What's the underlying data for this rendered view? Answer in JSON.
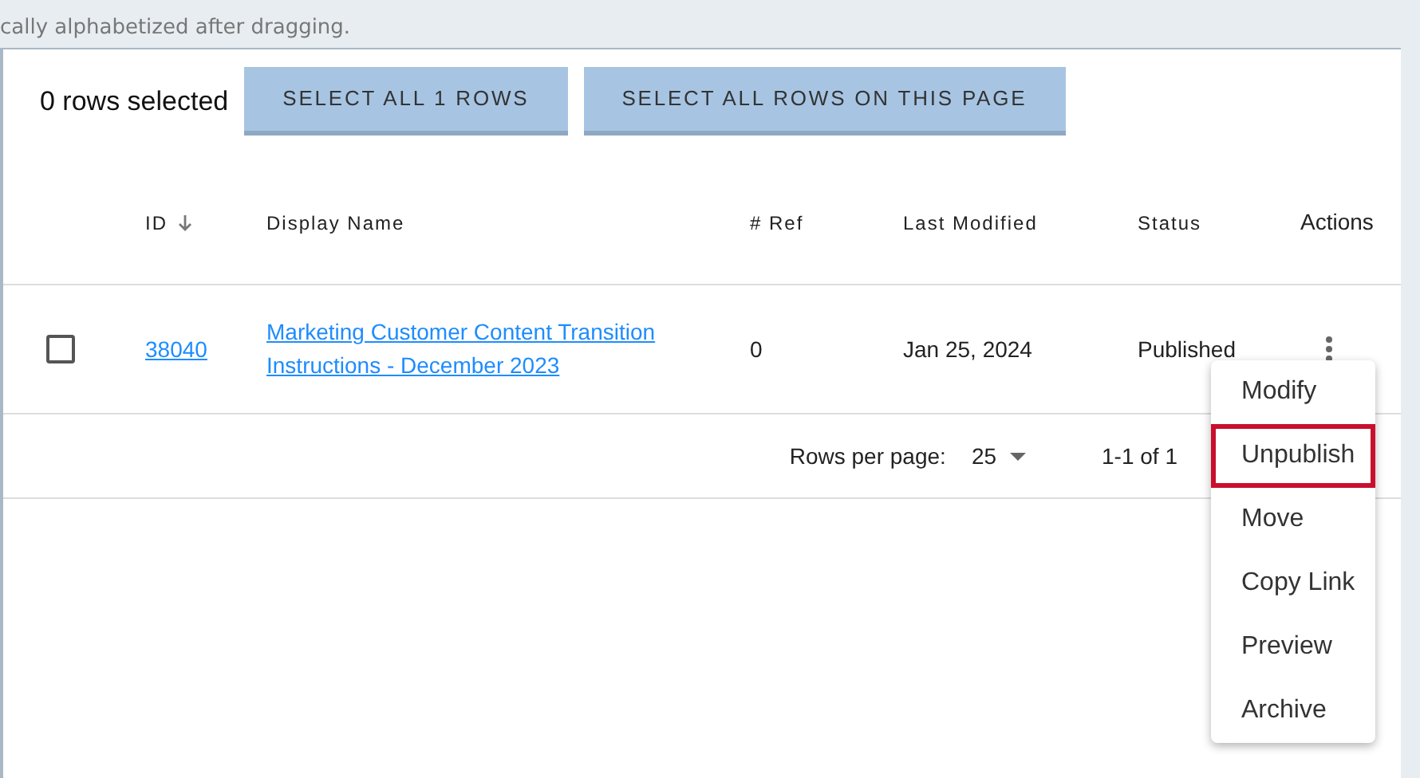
{
  "hint": "cally alphabetized after dragging.",
  "selection": {
    "count_text": "0 rows selected",
    "buttons": [
      "SELECT ALL 1 ROWS",
      "SELECT ALL ROWS ON THIS PAGE"
    ]
  },
  "table": {
    "columns": [
      {
        "label": "ID",
        "sorted": true
      },
      {
        "label": "Display Name",
        "sorted": false
      },
      {
        "label": "# Ref",
        "sorted": false
      },
      {
        "label": "Last Modified",
        "sorted": false
      },
      {
        "label": "Status",
        "sorted": false
      },
      {
        "label": "Actions",
        "sorted": false
      }
    ],
    "rows": [
      {
        "checked": false,
        "id": "38040",
        "display_name": "Marketing Customer Content Transition Instructions - December 2023",
        "ref": "0",
        "last_modified": "Jan 25, 2024",
        "status": "Published"
      }
    ]
  },
  "footer": {
    "rows_per_page_label": "Rows per page:",
    "rows_per_page": "25",
    "range": "1-1 of 1"
  },
  "action_menu": [
    {
      "label": "Modify",
      "highlighted": false
    },
    {
      "label": "Unpublish",
      "highlighted": true
    },
    {
      "label": "Move",
      "highlighted": false
    },
    {
      "label": "Copy Link",
      "highlighted": false
    },
    {
      "label": "Preview",
      "highlighted": false
    },
    {
      "label": "Archive",
      "highlighted": false
    }
  ]
}
